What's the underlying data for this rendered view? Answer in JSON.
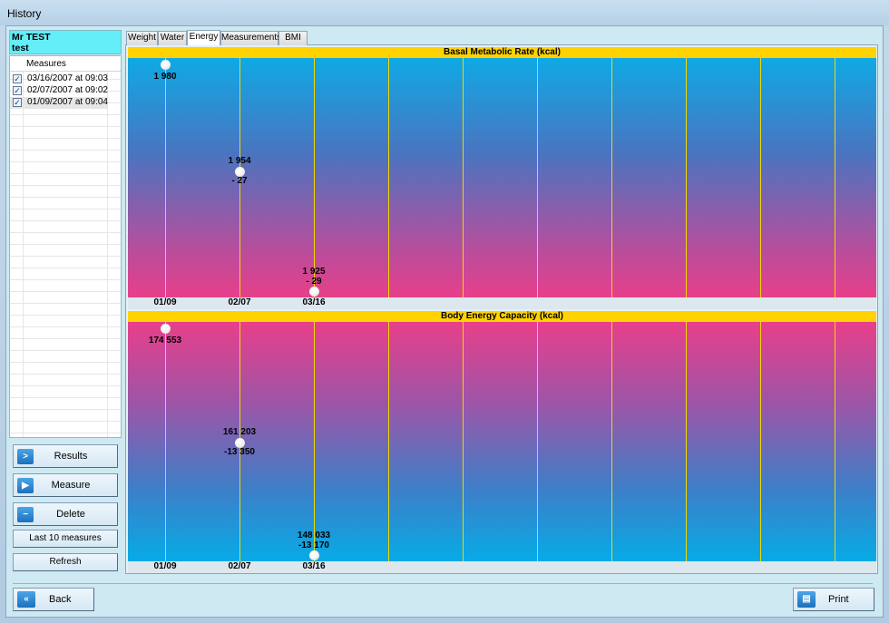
{
  "window": {
    "title": "History"
  },
  "user": {
    "name": "Mr TEST",
    "sub": "test"
  },
  "measures": {
    "header": "Measures",
    "items": [
      {
        "label": "03/16/2007 at 09:03",
        "checked": true,
        "selected": false
      },
      {
        "label": "02/07/2007 at 09:02",
        "checked": true,
        "selected": false
      },
      {
        "label": "01/09/2007 at 09:04",
        "checked": true,
        "selected": true
      }
    ]
  },
  "buttons": {
    "results": "Results",
    "measure": "Measure",
    "delete": "Delete",
    "last10": "Last 10 measures",
    "refresh": "Refresh",
    "back": "Back",
    "print": "Print"
  },
  "icons": {
    "results": "chevron-right-icon",
    "measure": "play-icon",
    "delete": "minus-icon",
    "back": "double-chevron-left-icon",
    "print": "document-icon"
  },
  "tabs": [
    {
      "label": "Weight",
      "active": false
    },
    {
      "label": "Water",
      "active": false
    },
    {
      "label": "Energy",
      "active": true
    },
    {
      "label": "Measurements",
      "active": false
    },
    {
      "label": "BMI",
      "active": false
    }
  ],
  "chart_data": [
    {
      "type": "line",
      "title": "Basal Metabolic Rate (kcal)",
      "categories": [
        "01/09",
        "02/07",
        "03/16"
      ],
      "values": [
        1980,
        1954,
        1925
      ],
      "value_labels": [
        "1 980",
        "1 954",
        "1 925"
      ],
      "delta_labels": [
        "",
        "- 27",
        "- 29"
      ],
      "ylim": [
        1925,
        1980
      ],
      "grid": true,
      "colors": {
        "title_bar": "#ffd200",
        "gridline": "#f0d800",
        "point": "#ffffff"
      }
    },
    {
      "type": "line",
      "title": "Body Energy Capacity (kcal)",
      "categories": [
        "01/09",
        "02/07",
        "03/16"
      ],
      "values": [
        174553,
        161203,
        148033
      ],
      "value_labels": [
        "174 553",
        "161 203",
        "148 033"
      ],
      "delta_labels": [
        "",
        "-13 350",
        "-13 170"
      ],
      "ylim": [
        148033,
        174553
      ],
      "grid": true,
      "colors": {
        "title_bar": "#ffd200",
        "gridline": "#f0d800",
        "point": "#ffffff"
      }
    }
  ]
}
